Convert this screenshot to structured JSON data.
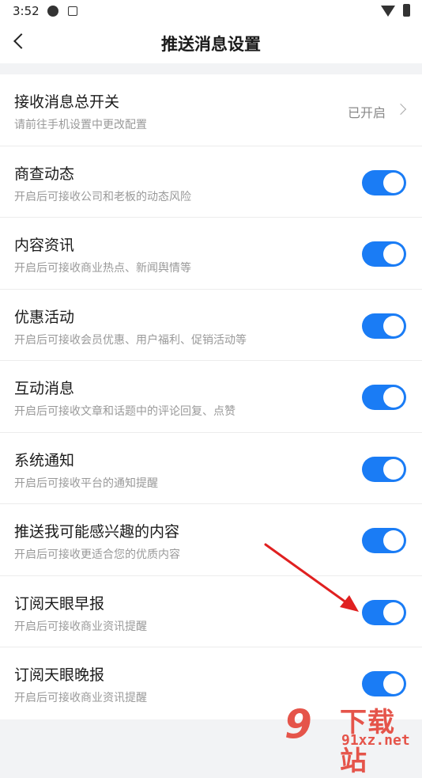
{
  "status_bar": {
    "time": "3:52"
  },
  "nav": {
    "title": "推送消息设置"
  },
  "master": {
    "title": "接收消息总开关",
    "subtitle": "请前往手机设置中更改配置",
    "status": "已开启"
  },
  "items": [
    {
      "title": "商查动态",
      "subtitle": "开启后可接收公司和老板的动态风险",
      "on": true
    },
    {
      "title": "内容资讯",
      "subtitle": "开启后可接收商业热点、新闻舆情等",
      "on": true
    },
    {
      "title": "优惠活动",
      "subtitle": "开启后可接收会员优惠、用户福利、促销活动等",
      "on": true
    },
    {
      "title": "互动消息",
      "subtitle": "开启后可接收文章和话题中的评论回复、点赞",
      "on": true
    },
    {
      "title": "系统通知",
      "subtitle": "开启后可接收平台的通知提醒",
      "on": true
    },
    {
      "title": "推送我可能感兴趣的内容",
      "subtitle": "开启后可接收更适合您的优质内容",
      "on": true
    },
    {
      "title": "订阅天眼早报",
      "subtitle": "开启后可接收商业资讯提醒",
      "on": true
    },
    {
      "title": "订阅天眼晚报",
      "subtitle": "开启后可接收商业资讯提醒",
      "on": true
    }
  ],
  "watermark": {
    "top": "下载站",
    "bottom": "91xz.net"
  },
  "colors": {
    "accent": "#1a7cf5",
    "annotation": "#e02020",
    "watermark": "#e5544a"
  }
}
